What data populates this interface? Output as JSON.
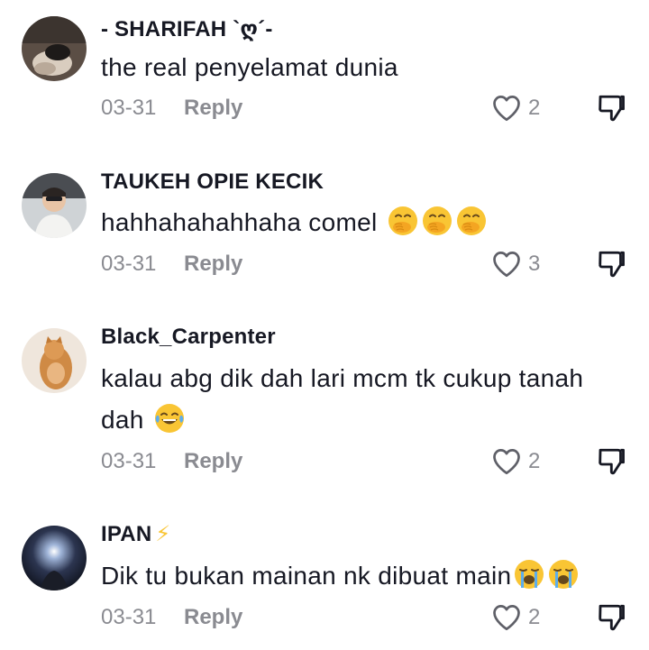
{
  "comments": [
    {
      "username": "- SHARIFAH `ღ´-",
      "text": "the real penyelamat dunia",
      "emojis": "",
      "date": "03-31",
      "reply_label": "Reply",
      "likes": "2"
    },
    {
      "username": "TAUKEH OPIE KECIK",
      "text": "hahhahahahhaha comel",
      "emojis": "🤭🤭🤭",
      "date": "03-31",
      "reply_label": "Reply",
      "likes": "3"
    },
    {
      "username": "Black_Carpenter",
      "text": "kalau abg dik dah lari mcm tk cukup tanah dah",
      "emojis": "😂",
      "date": "03-31",
      "reply_label": "Reply",
      "likes": "2"
    },
    {
      "username": "IPAN",
      "username_emoji": "⚡",
      "text": "Dik tu bukan mainan nk dibuat main",
      "emojis": "😭😭",
      "date": "03-31",
      "reply_label": "Reply",
      "likes": "2"
    }
  ],
  "icons": {
    "like": "heart-outline-icon",
    "dislike": "thumbs-down-outline-icon",
    "emoji_hand_over_mouth": "face-with-hand-over-mouth-emoji",
    "emoji_tears_of_joy": "face-with-tears-of-joy-emoji",
    "emoji_crying": "loudly-crying-face-emoji",
    "emoji_lightning": "high-voltage-emoji"
  },
  "colors": {
    "text": "#161823",
    "secondary": "#8a8b91",
    "emoji_yellow": "#f9c534"
  }
}
